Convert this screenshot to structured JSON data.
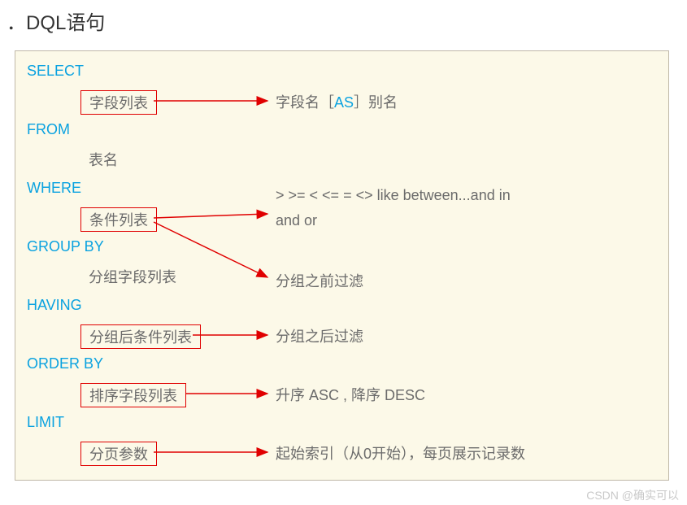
{
  "title": "．DQL语句",
  "clauses": {
    "select": {
      "keyword": "SELECT",
      "box": "字段列表",
      "desc_pre": "字段名［",
      "desc_kw": "AS",
      "desc_post": "］别名"
    },
    "from": {
      "keyword": "FROM",
      "plain": "表名"
    },
    "where": {
      "keyword": "WHERE",
      "box": "条件列表",
      "desc_line1": "> >= < <= = <>  like  between...and   in",
      "desc_line2": "and   or",
      "desc_extra": "分组之前过滤"
    },
    "groupby": {
      "keyword": "GROUP  BY",
      "plain": "分组字段列表"
    },
    "having": {
      "keyword": "HAVING",
      "box": "分组后条件列表",
      "desc": "分组之后过滤"
    },
    "orderby": {
      "keyword": "ORDER BY",
      "box": "排序字段列表",
      "desc": "升序 ASC , 降序 DESC"
    },
    "limit": {
      "keyword": "LIMIT",
      "box": "分页参数",
      "desc": "起始索引（从0开始），每页展示记录数"
    }
  },
  "watermark": "CSDN @确实可以"
}
